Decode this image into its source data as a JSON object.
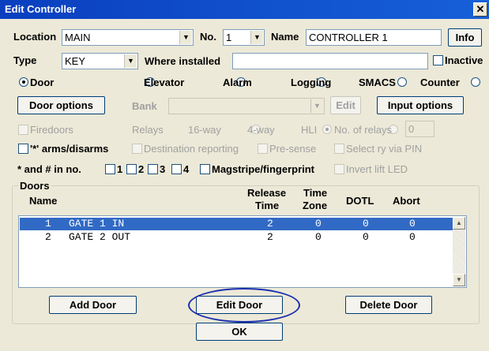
{
  "window": {
    "title": "Edit Controller",
    "close_glyph": "✕"
  },
  "location": {
    "label": "Location",
    "value": "MAIN"
  },
  "number": {
    "label": "No.",
    "value": "1"
  },
  "name": {
    "label": "Name",
    "value": "CONTROLLER 1"
  },
  "info_button": "Info",
  "type": {
    "label": "Type",
    "value": "KEY"
  },
  "where_installed": {
    "label": "Where installed",
    "value": ""
  },
  "inactive": {
    "label": "Inactive",
    "checked": false
  },
  "mode_radios": [
    {
      "label": "Door",
      "selected": true
    },
    {
      "label": "Elevator",
      "selected": false
    },
    {
      "label": "Alarm",
      "selected": false
    },
    {
      "label": "Logging",
      "selected": false
    },
    {
      "label": "SMACS",
      "selected": false
    },
    {
      "label": "Counter",
      "selected": false
    }
  ],
  "door_options_button": "Door options",
  "bank": {
    "label": "Bank",
    "value": ""
  },
  "edit_button": "Edit",
  "input_options_button": "Input options",
  "firedoors": {
    "label": "Firedoors",
    "checked": false
  },
  "relays": {
    "label": "Relays",
    "options": [
      {
        "label": "16-way",
        "selected": false
      },
      {
        "label": "4-way",
        "selected": true
      },
      {
        "label": "HLI",
        "selected": false
      }
    ]
  },
  "no_of_relays": {
    "label": "No. of relays",
    "value": "0"
  },
  "arms_disarms": {
    "label": "'*' arms/disarms",
    "checked": false
  },
  "destination_reporting": {
    "label": "Destination reporting",
    "checked": false
  },
  "pre_sense": {
    "label": "Pre-sense",
    "checked": false
  },
  "select_ry_via_pin": {
    "label": "Select ry via PIN",
    "checked": false
  },
  "star_hash": {
    "label": "* and # in no.",
    "options": [
      "1",
      "2",
      "3",
      "4"
    ]
  },
  "magstripe": {
    "label": "Magstripe/fingerprint",
    "checked": false
  },
  "invert_lift_led": {
    "label": "Invert lift LED",
    "checked": false
  },
  "doors": {
    "group_label": "Doors",
    "columns": {
      "name": "Name",
      "release_time_1": "Release",
      "release_time_2": "Time",
      "time_zone_1": "Time",
      "time_zone_2": "Zone",
      "dotl": "DOTL",
      "abort": "Abort"
    },
    "rows": [
      {
        "num": "1",
        "name": "GATE 1 IN",
        "release": "2",
        "zone": "0",
        "dotl": "0",
        "abort": "0",
        "selected": true
      },
      {
        "num": "2",
        "name": "GATE 2 OUT",
        "release": "2",
        "zone": "0",
        "dotl": "0",
        "abort": "0",
        "selected": false
      }
    ]
  },
  "add_door_button": "Add Door",
  "edit_door_button": "Edit Door",
  "delete_door_button": "Delete Door",
  "ok_button": "OK",
  "colors": {
    "title_bar": "#0a3fbf",
    "selection": "#316ac5",
    "highlight_ellipse": "#1a2fb0"
  }
}
